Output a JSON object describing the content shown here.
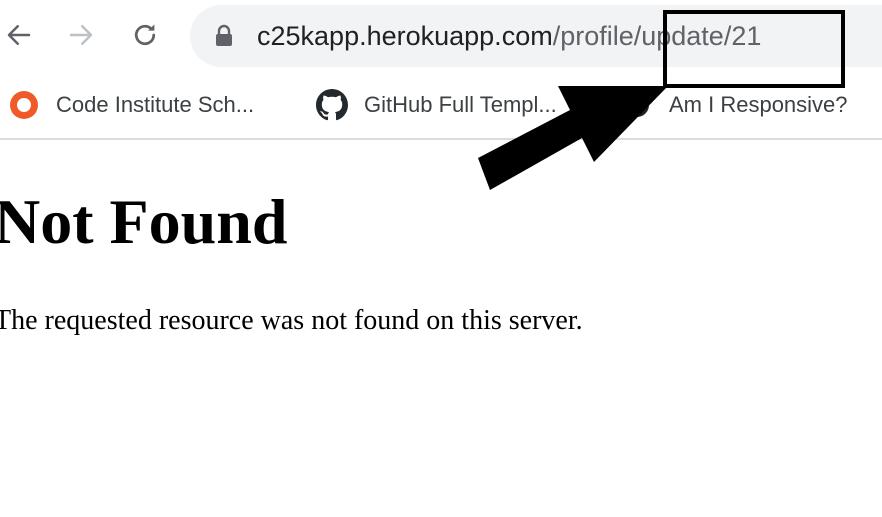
{
  "browser": {
    "url_host": "c25kapp.herokuapp.com",
    "url_path": "/profile/update/21",
    "bookmarks": [
      {
        "label": "Code Institute Sch...",
        "icon": "code-institute-icon",
        "color": "#f05a28"
      },
      {
        "label": "GitHub Full Templ...",
        "icon": "github-icon",
        "color": "#24292e"
      },
      {
        "label": "Am I Responsive?",
        "icon": "globe-icon",
        "color": "#202124"
      }
    ]
  },
  "page": {
    "title": "Not Found",
    "message": "The requested resource was not found on this server."
  },
  "annotation": {
    "color": "#000000"
  }
}
